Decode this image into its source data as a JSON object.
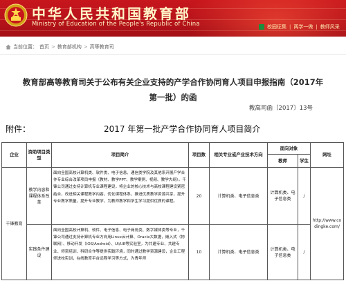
{
  "header": {
    "title_cn": "中华人民共和国教育部",
    "title_en": "Ministry of Education of the People's Republic of China",
    "links": [
      "校园征集",
      "两学一做",
      "教师风采"
    ],
    "colors": {
      "bg": "#c8161d",
      "text": "#fff5c8"
    }
  },
  "breadcrumb": {
    "items": [
      "当前位置：",
      "首页",
      "教育部机构",
      "高等教育司"
    ],
    "separator": ">"
  },
  "article": {
    "title": "教育部高等教育司关于公布有关企业支持的产学合作协同育人项目申报指南（2017年第一批）的函",
    "doc_no": "教高司函〔2017〕13号",
    "attach_label": "附件：",
    "attach_title": "2017 年第一批产学合作协同育人项目简介"
  },
  "table": {
    "headers": {
      "company": "企业",
      "funding_type": "资助项目类型",
      "intro": "项目简介",
      "count": "项目数",
      "related": "相关专业或产业技术方向",
      "target": "面向对象",
      "teacher": "教师",
      "student": "学生",
      "url": "网址"
    },
    "company": "千锋教育",
    "url": "http://www.codingke.com/",
    "rows": [
      {
        "type": "教学内容和课程体系改革",
        "intro": "面向全国高校计算机类、软件类、电子信息、通信类学院及其他系开展产学合作专业综合改革项目申报（教材、教学PPT、教学案例、视频、教学大纲）。千锋公司通过支持计算机专业课程建设，将企业的核心技术与高校课程建设紧密结合，改进相关课程教学内容，优化课程体系，推进优质教学资源共享，提升专业教学质量，提升专业教学，为教师教学和学生学习提供优质的课程。",
        "count": "20",
        "related": "计算机类、电子信息类",
        "teacher": "计算机类、电子信息类",
        "student": "/"
      },
      {
        "type": "实践条件建设",
        "intro": "面向全国高校计算机、软件、电子信息、电子商务类、数字媒体类等专业，千锋公司通过支持计算机专业方向用Linux云计算、Oracle大数据，嵌入式（物联网）、移动开发（IOS/Android）、UI/UE等实验室，为共建专业、共建专业、师资培训、科研合作等提供实践环境，同时通过教学资源建设，企业工程师进校实训，在线教育平台远程学习等方式，为青年师",
        "count": "10",
        "related": "计算机类、电子信息类",
        "teacher": "计算机类、电子信息类",
        "student": "/"
      }
    ]
  }
}
